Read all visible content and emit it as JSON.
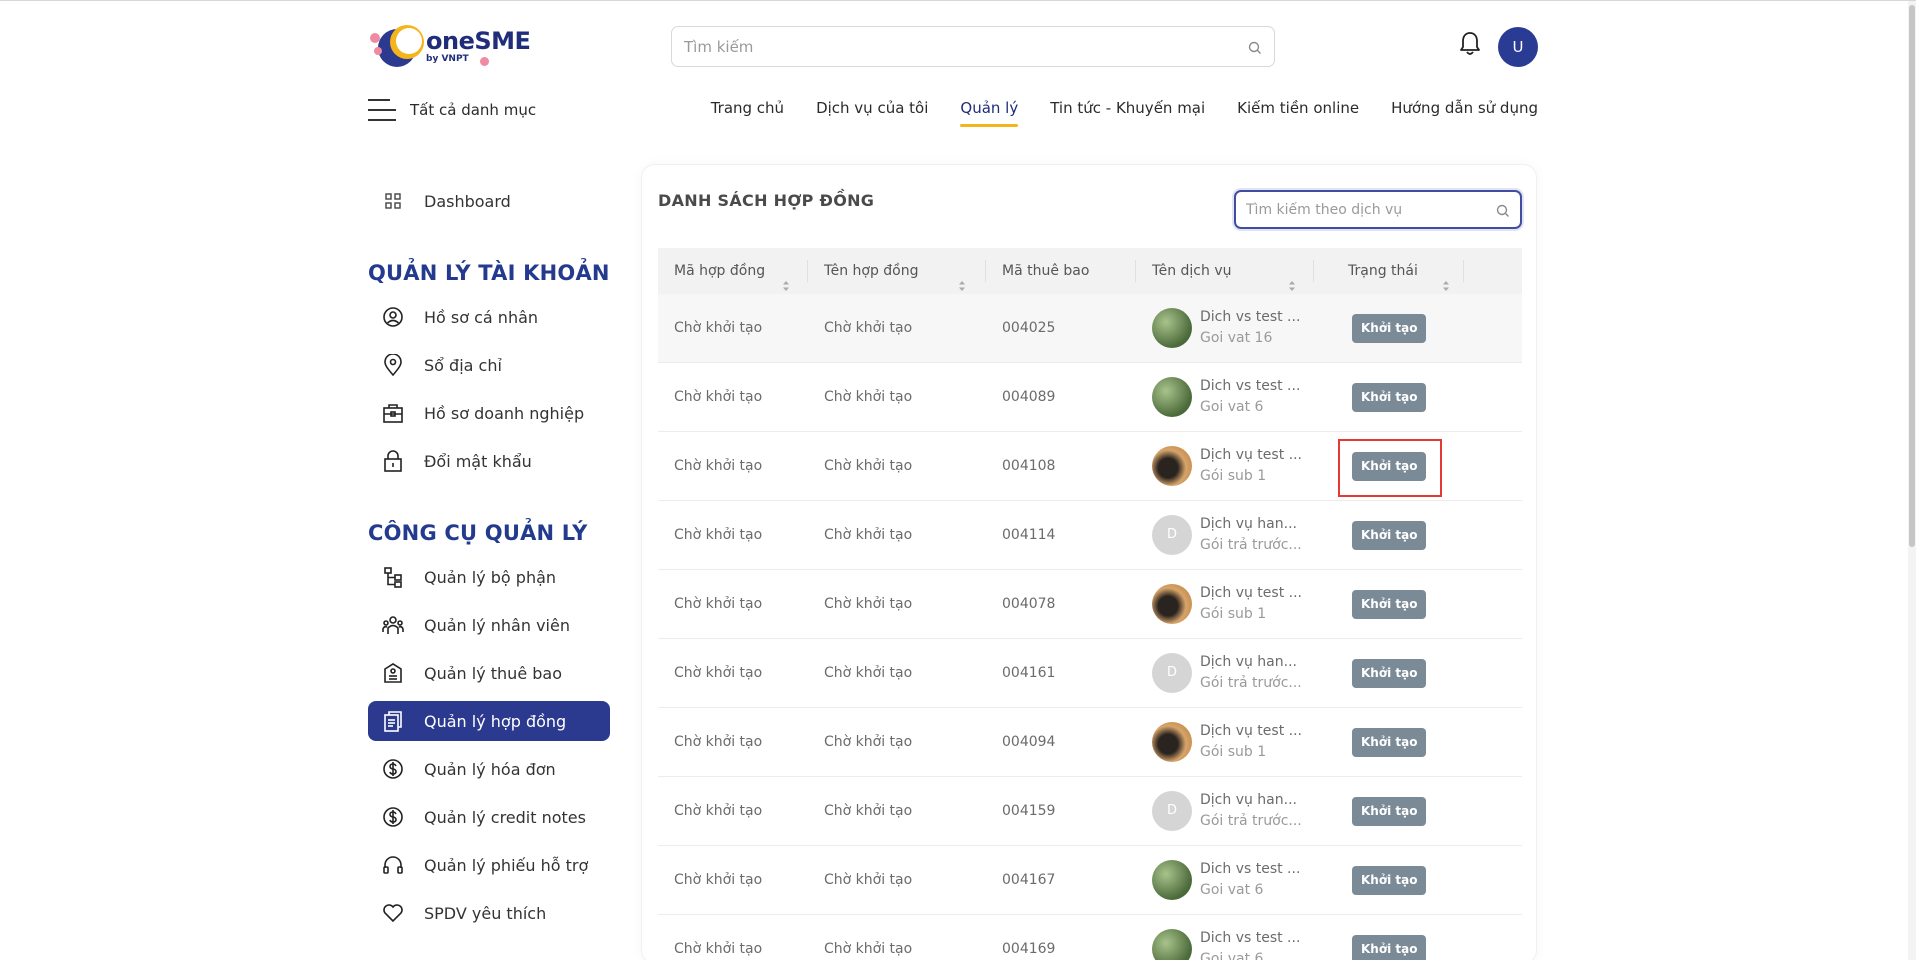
{
  "header": {
    "logo_text": "oneSME",
    "logo_sub": "by VNPT",
    "search_placeholder": "Tìm kiếm",
    "avatar_initial": "U",
    "all_categories": "Tất cả danh mục",
    "nav": [
      "Trang chủ",
      "Dịch vụ của tôi",
      "Quản lý",
      "Tin tức - Khuyến mại",
      "Kiếm tiền online",
      "Hướng dẫn sử dụng"
    ],
    "nav_active_index": 2
  },
  "sidebar": {
    "dashboard": "Dashboard",
    "account_heading": "QUẢN LÝ TÀI KHOẢN",
    "account_items": [
      {
        "label": "Hồ sơ cá nhân",
        "icon": "user-circle-icon"
      },
      {
        "label": "Sổ địa chỉ",
        "icon": "location-pin-icon"
      },
      {
        "label": "Hồ sơ doanh nghiệp",
        "icon": "briefcase-icon"
      },
      {
        "label": "Đổi mật khẩu",
        "icon": "lock-icon"
      }
    ],
    "tools_heading": "CÔNG CỤ QUẢN LÝ",
    "tool_items": [
      {
        "label": "Quản lý bộ phận",
        "icon": "org-tree-icon"
      },
      {
        "label": "Quản lý nhân viên",
        "icon": "people-icon"
      },
      {
        "label": "Quản lý thuê bao",
        "icon": "subscription-icon"
      },
      {
        "label": "Quản lý hợp đồng",
        "icon": "contract-icon",
        "active": true
      },
      {
        "label": "Quản lý hóa đơn",
        "icon": "dollar-circle-icon"
      },
      {
        "label": "Quản lý credit notes",
        "icon": "dollar-circle-icon"
      },
      {
        "label": "Quản lý phiếu hỗ trợ",
        "icon": "headset-icon"
      },
      {
        "label": "SPDV yêu thích",
        "icon": "heart-icon"
      }
    ]
  },
  "main": {
    "title": "DANH SÁCH HỢP ĐỒNG",
    "search_placeholder": "Tìm kiếm theo dịch vụ",
    "columns": [
      "Mã hợp đồng",
      "Tên hợp đồng",
      "Mã thuê bao",
      "Tên dịch vụ",
      "Trạng thái"
    ],
    "rows": [
      {
        "code": "Chờ khởi tạo",
        "name": "Chờ khởi tạo",
        "sub": "004025",
        "svc": "Dich vs test ...",
        "plan": "Goi vat 16",
        "thumb": "green",
        "status": "Khởi tạo"
      },
      {
        "code": "Chờ khởi tạo",
        "name": "Chờ khởi tạo",
        "sub": "004089",
        "svc": "Dich vs test ...",
        "plan": "Goi vat 6",
        "thumb": "green",
        "status": "Khởi tạo"
      },
      {
        "code": "Chờ khởi tạo",
        "name": "Chờ khởi tạo",
        "sub": "004108",
        "svc": "Dịch vụ test ...",
        "plan": "Gói sub 1",
        "thumb": "brown",
        "status": "Khởi tạo"
      },
      {
        "code": "Chờ khởi tạo",
        "name": "Chờ khởi tạo",
        "sub": "004114",
        "svc": "Dịch vụ han...",
        "plan": "Gói trả trước...",
        "thumb": "initial",
        "initial": "D",
        "status": "Khởi tạo"
      },
      {
        "code": "Chờ khởi tạo",
        "name": "Chờ khởi tạo",
        "sub": "004078",
        "svc": "Dịch vụ test ...",
        "plan": "Gói sub 1",
        "thumb": "brown",
        "status": "Khởi tạo"
      },
      {
        "code": "Chờ khởi tạo",
        "name": "Chờ khởi tạo",
        "sub": "004161",
        "svc": "Dịch vụ han...",
        "plan": "Gói trả trước...",
        "thumb": "initial",
        "initial": "D",
        "status": "Khởi tạo"
      },
      {
        "code": "Chờ khởi tạo",
        "name": "Chờ khởi tạo",
        "sub": "004094",
        "svc": "Dịch vụ test ...",
        "plan": "Gói sub 1",
        "thumb": "brown",
        "status": "Khởi tạo"
      },
      {
        "code": "Chờ khởi tạo",
        "name": "Chờ khởi tạo",
        "sub": "004159",
        "svc": "Dịch vụ han...",
        "plan": "Gói trả trước...",
        "thumb": "initial",
        "initial": "D",
        "status": "Khởi tạo"
      },
      {
        "code": "Chờ khởi tạo",
        "name": "Chờ khởi tạo",
        "sub": "004167",
        "svc": "Dich vs test ...",
        "plan": "Goi vat 6",
        "thumb": "green",
        "status": "Khởi tạo"
      },
      {
        "code": "Chờ khởi tạo",
        "name": "Chờ khởi tạo",
        "sub": "004169",
        "svc": "Dich vs test ...",
        "plan": "Goi vat 6",
        "thumb": "green",
        "status": "Khởi tạo"
      }
    ]
  },
  "colors": {
    "primary": "#2b3a8f",
    "accent": "#f4b51c",
    "badge": "#7a8a97",
    "highlight": "#e53935"
  }
}
